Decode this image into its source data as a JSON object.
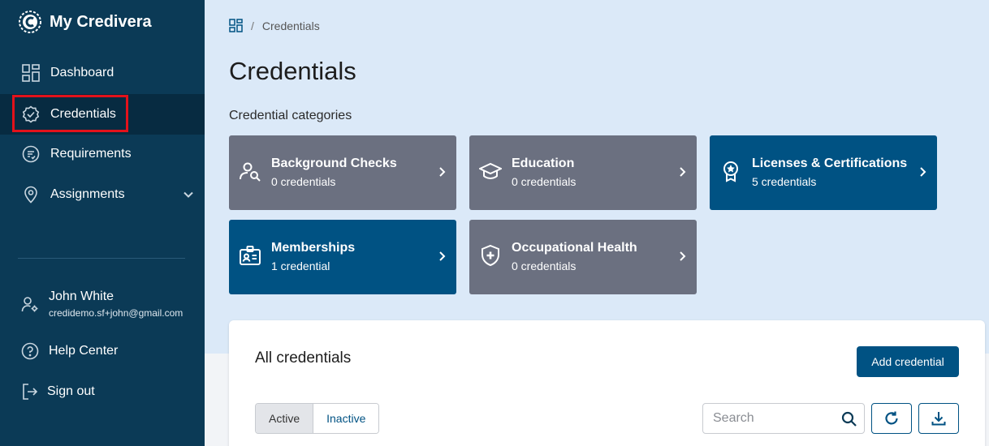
{
  "brand": {
    "name": "My Credivera"
  },
  "nav": {
    "dashboard": "Dashboard",
    "credentials": "Credentials",
    "requirements": "Requirements",
    "assignments": "Assignments"
  },
  "user": {
    "name": "John White",
    "email": "credidemo.sf+john@gmail.com"
  },
  "footer": {
    "help": "Help Center",
    "signout": "Sign out"
  },
  "breadcrumb": {
    "sep": "/",
    "current": "Credentials"
  },
  "page": {
    "title": "Credentials",
    "categories_heading": "Credential categories"
  },
  "categories": [
    {
      "title": "Background Checks",
      "count": "0 credentials"
    },
    {
      "title": "Education",
      "count": "0 credentials"
    },
    {
      "title": "Licenses & Certifications",
      "count": "5 credentials"
    },
    {
      "title": "Memberships",
      "count": "1 credential"
    },
    {
      "title": "Occupational Health",
      "count": "0 credentials"
    }
  ],
  "panel": {
    "title": "All credentials",
    "add_label": "Add credential",
    "toggle": {
      "active": "Active",
      "inactive": "Inactive"
    },
    "search_placeholder": "Search"
  },
  "colors": {
    "sidebar": "#0b3a56",
    "accent": "#005283",
    "card_gray": "#6b7080",
    "highlight": "#e3121b"
  }
}
